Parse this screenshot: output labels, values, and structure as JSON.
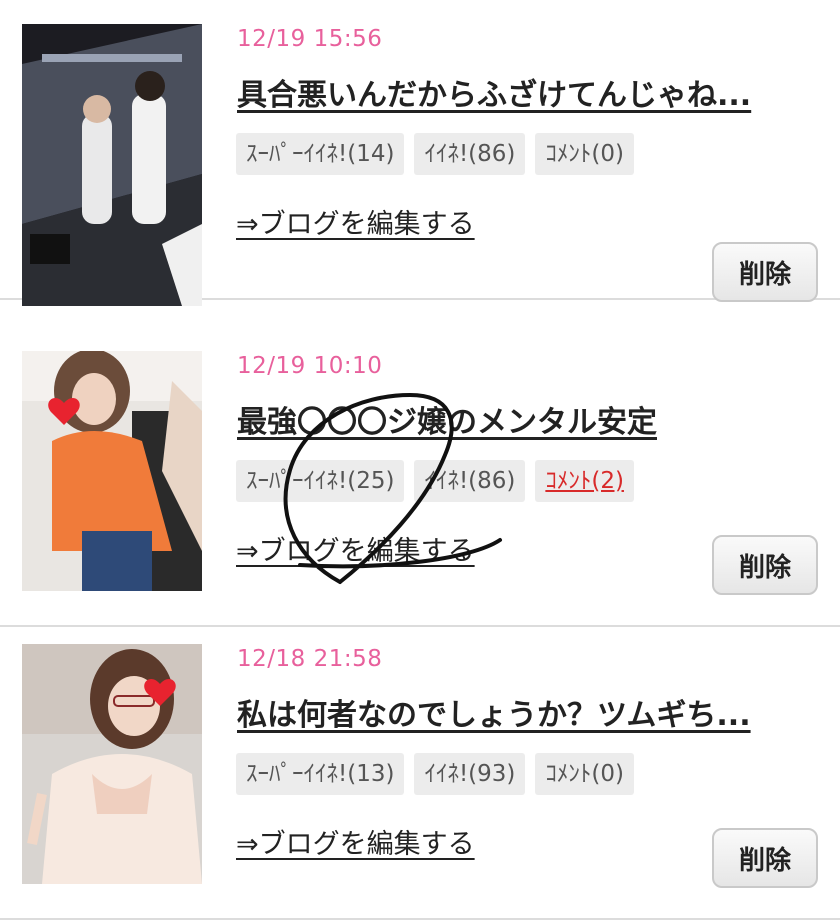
{
  "entries": [
    {
      "date": "12/19 15:56",
      "title": "具合悪いんだからふざけてんじゃね...",
      "super_like": "ｽｰﾊﾟｰｲｲﾈ!(14)",
      "like": "ｲｲﾈ!(86)",
      "comment": "ｺﾒﾝﾄ(0)",
      "edit_link": "⇒ブログを編集する",
      "delete_label": "削除"
    },
    {
      "date": "12/19 10:10",
      "title": "最強〇〇〇ジ嬢のメンタル安定",
      "super_like": "ｽｰﾊﾟｰｲｲﾈ!(25)",
      "like": "ｲｲﾈ!(86)",
      "comment": "ｺﾒﾝﾄ(2)",
      "edit_link": "⇒ブログを編集する",
      "delete_label": "削除"
    },
    {
      "date": "12/18 21:58",
      "title": "私は何者なのでしょうか？ツムギち...",
      "super_like": "ｽｰﾊﾟｰｲｲﾈ!(13)",
      "like": "ｲｲﾈ!(93)",
      "comment": "ｺﾒﾝﾄ(0)",
      "edit_link": "⇒ブログを編集する",
      "delete_label": "削除"
    }
  ],
  "colors": {
    "date": "#e8609c",
    "comment_active": "#d82a2a",
    "badge_bg": "#ececec",
    "divider": "#dcdcdc"
  }
}
